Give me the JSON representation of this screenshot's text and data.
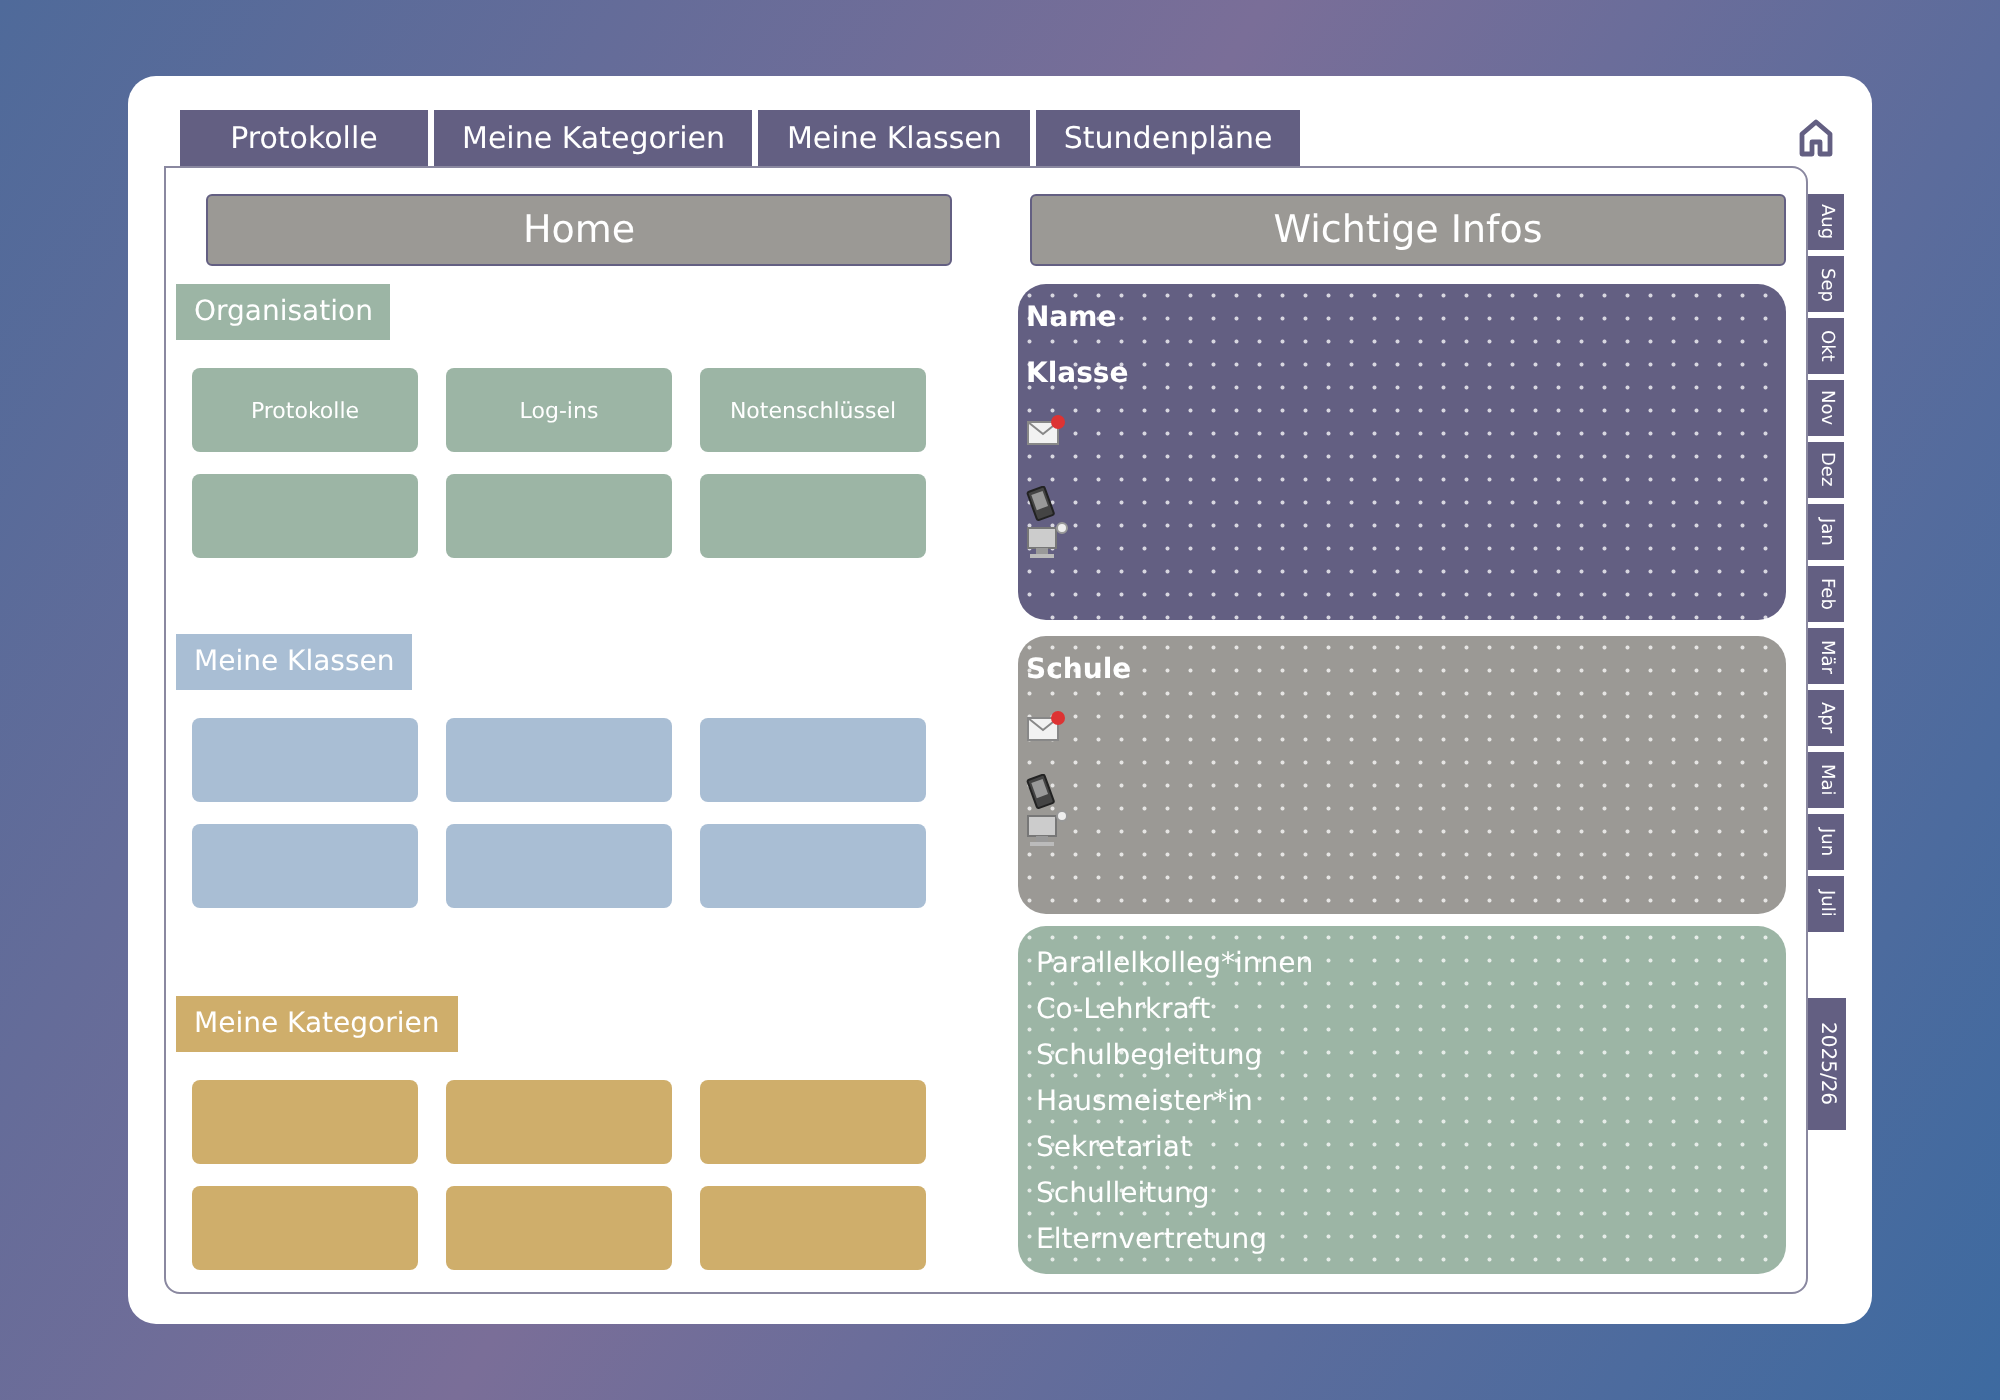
{
  "tabs": [
    {
      "label": "Protokolle"
    },
    {
      "label": "Meine Kategorien"
    },
    {
      "label": "Meine Klassen"
    },
    {
      "label": "Stundenpläne"
    }
  ],
  "home": {
    "title": "Home",
    "sections": [
      {
        "title": "Organisation",
        "color": "#9cb5a5",
        "tiles": [
          {
            "kind": "labeled",
            "label": "Protokolle"
          },
          {
            "kind": "labeled",
            "label": "Log-ins"
          },
          {
            "kind": "labeled",
            "label": "Notenschlüssel"
          },
          {
            "kind": "blank"
          },
          {
            "kind": "blank"
          },
          {
            "kind": "blank"
          }
        ]
      },
      {
        "title": "Meine Klassen",
        "color": "#a9bed4",
        "tiles": [
          {
            "kind": "blank"
          },
          {
            "kind": "blank"
          },
          {
            "kind": "blank"
          },
          {
            "kind": "blank"
          },
          {
            "kind": "blank"
          },
          {
            "kind": "blank"
          }
        ]
      },
      {
        "title": "Meine Kategorien",
        "color": "#cfae6b",
        "tiles": [
          {
            "kind": "blank"
          },
          {
            "kind": "blank"
          },
          {
            "kind": "blank"
          },
          {
            "kind": "blank"
          },
          {
            "kind": "blank"
          },
          {
            "kind": "blank"
          }
        ]
      }
    ]
  },
  "infos": {
    "title": "Wichtige Infos",
    "cards": [
      {
        "kind": "contact",
        "color": "#635f82",
        "labels": [
          "Name",
          "Klasse"
        ]
      },
      {
        "kind": "contact",
        "color": "#9b9995",
        "labels": [
          "Schule"
        ]
      },
      {
        "kind": "list",
        "color": "#9cb5a5",
        "items": [
          "Parallelkolleg*innen",
          "Co-Lehrkraft",
          "Schulbegleitung",
          "Hausmeister*in",
          "Sekretariat",
          "Schulleitung",
          "Elternvertretung"
        ]
      }
    ]
  },
  "months": [
    "Aug",
    "Sep",
    "Okt",
    "Nov",
    "Dez",
    "Jan",
    "Feb",
    "Mär",
    "Apr",
    "Mai",
    "Jun",
    "Juli"
  ],
  "year": "2025/26"
}
